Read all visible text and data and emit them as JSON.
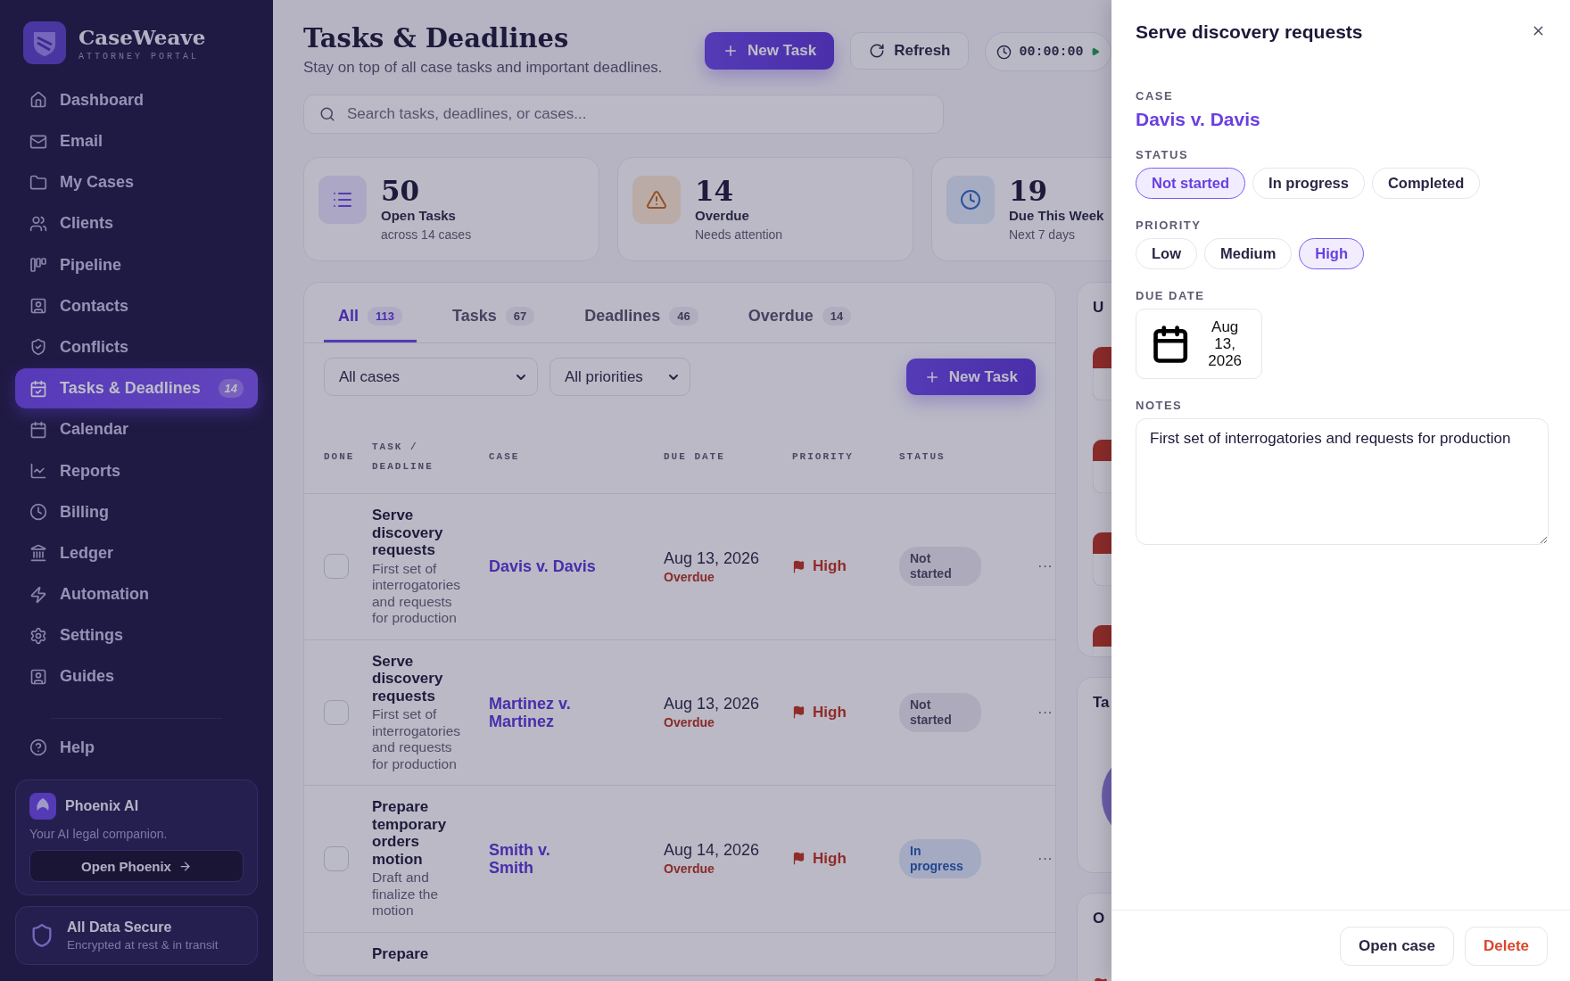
{
  "sidebar": {
    "brand": "CaseWeave",
    "brand_tagline": "ATTORNEY PORTAL",
    "items": [
      {
        "label": "Dashboard",
        "selected": false
      },
      {
        "label": "Email",
        "selected": false
      },
      {
        "label": "My Cases",
        "selected": false
      },
      {
        "label": "Clients",
        "selected": false
      },
      {
        "label": "Pipeline",
        "selected": false
      },
      {
        "label": "Contacts",
        "selected": false
      },
      {
        "label": "Conflicts",
        "selected": false
      },
      {
        "label": "Tasks & Deadlines",
        "selected": true,
        "badge": "14"
      },
      {
        "label": "Calendar",
        "selected": false
      },
      {
        "label": "Reports",
        "selected": false
      },
      {
        "label": "Billing",
        "selected": false
      },
      {
        "label": "Ledger",
        "selected": false
      },
      {
        "label": "Automation",
        "selected": false
      },
      {
        "label": "Settings",
        "selected": false
      },
      {
        "label": "Guides",
        "selected": false
      }
    ],
    "help": "Help",
    "assistant": {
      "name": "Phoenix AI",
      "tagline": "Your AI legal companion.",
      "button": "Open Phoenix"
    },
    "security": {
      "title": "All Data Secure",
      "subtitle": "Encrypted at rest & in transit"
    }
  },
  "header": {
    "title": "Tasks & Deadlines",
    "subtitle": "Stay on top of all case tasks and important deadlines.",
    "new_task": "New Task",
    "refresh": "Refresh",
    "timer": "00:00:00"
  },
  "search": {
    "placeholder": "Search tasks, deadlines, or cases..."
  },
  "stats": [
    {
      "kind": "open",
      "value": "50",
      "label": "Open Tasks",
      "note": "across 14 cases"
    },
    {
      "kind": "overdue",
      "value": "14",
      "label": "Overdue",
      "note": "Needs attention"
    },
    {
      "kind": "week",
      "value": "19",
      "label": "Due This Week",
      "note": "Next 7 days"
    }
  ],
  "tabs": [
    {
      "label": "All",
      "count": "113",
      "selected": true
    },
    {
      "label": "Tasks",
      "count": "67",
      "selected": false
    },
    {
      "label": "Deadlines",
      "count": "46",
      "selected": false
    },
    {
      "label": "Overdue",
      "count": "14",
      "selected": false
    }
  ],
  "filters": [
    "All cases",
    "All priorities"
  ],
  "new_task_button": "New Task",
  "table": {
    "columns": [
      "DONE",
      "TASK / DEADLINE",
      "CASE",
      "DUE DATE",
      "PRIORITY",
      "STATUS"
    ],
    "rows": [
      {
        "checked": false,
        "title": "Serve discovery requests",
        "description": "First set of interrogatories and requests for production",
        "case": "Davis v. Davis",
        "due": "Aug 13, 2026",
        "due_note": "Overdue",
        "priority": {
          "label": "High",
          "kind": "high"
        },
        "status": {
          "label": "Not started",
          "kind": "not_started"
        },
        "actions": "···"
      },
      {
        "checked": false,
        "title": "Serve discovery requests",
        "description": "First set of interrogatories and requests for production",
        "case": "Martinez v. Martinez",
        "due": "Aug 13, 2026",
        "due_note": "Overdue",
        "priority": {
          "label": "High",
          "kind": "high"
        },
        "status": {
          "label": "Not started",
          "kind": "not_started"
        },
        "actions": "···"
      },
      {
        "checked": false,
        "title": "Prepare temporary orders motion",
        "description": "Draft and finalize the motion",
        "case": "Smith v. Smith",
        "due": "Aug 14, 2026",
        "due_note": "Overdue",
        "priority": {
          "label": "High",
          "kind": "high"
        },
        "status": {
          "label": "In progress",
          "kind": "in_progress"
        },
        "actions": "···"
      },
      {
        "title": "Prepare"
      }
    ]
  },
  "side_cards": [
    {
      "title": "U",
      "kind": "list"
    },
    {
      "title": "Ta",
      "kind": "chart"
    },
    {
      "title": "O",
      "kind": "flags"
    }
  ],
  "drawer": {
    "title": "Serve discovery requests",
    "case_label": "CASE",
    "case": "Davis v. Davis",
    "status_label": "STATUS",
    "status_options": [
      {
        "label": "Not started",
        "selected": true
      },
      {
        "label": "In progress",
        "selected": false
      },
      {
        "label": "Completed",
        "selected": false
      }
    ],
    "priority_label": "PRIORITY",
    "priority_options": [
      {
        "label": "Low",
        "selected": false
      },
      {
        "label": "Medium",
        "selected": false
      },
      {
        "label": "High",
        "selected": true
      }
    ],
    "due_label": "DUE DATE",
    "due": "Aug 13, 2026",
    "notes_label": "NOTES",
    "notes": "First set of interrogatories and requests for production",
    "open_case": "Open case",
    "delete": "Delete"
  }
}
